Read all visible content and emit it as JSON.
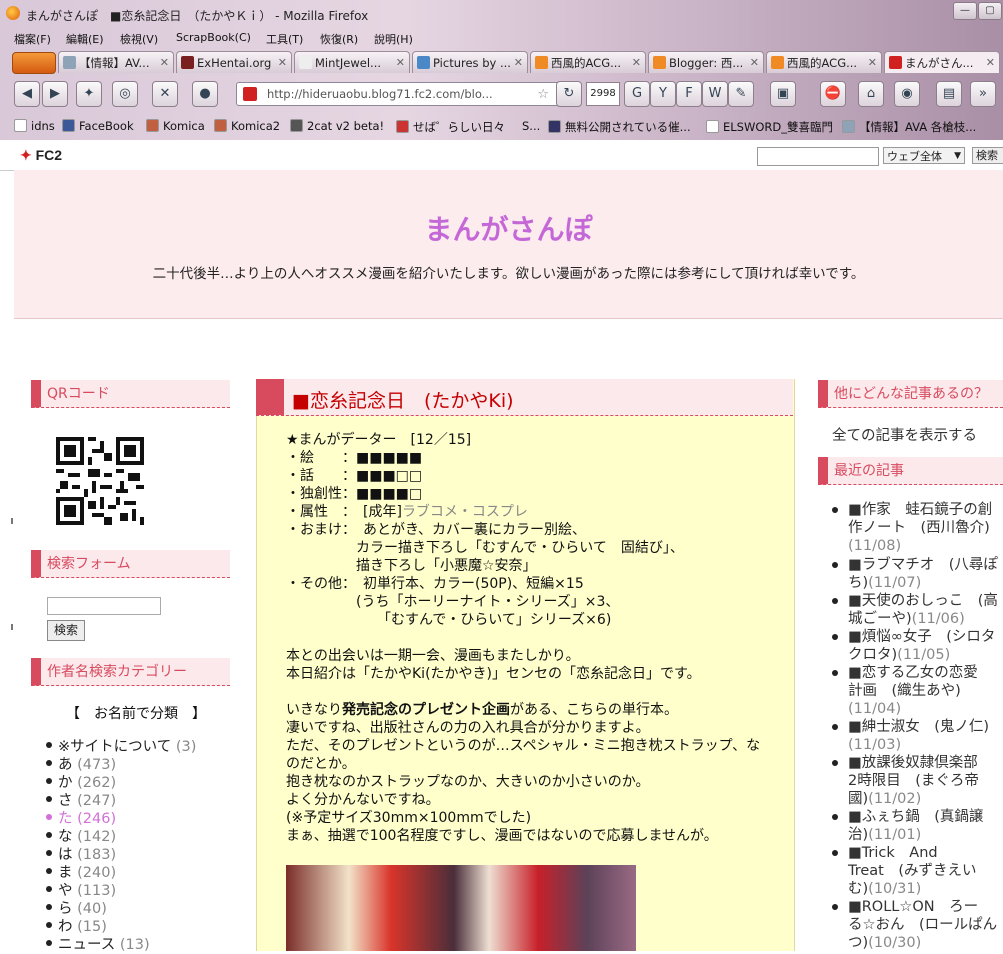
{
  "window": {
    "title": "まんがさんぽ　■恋糸記念日　（たかやＫｉ） - Mozilla Firefox",
    "buttons": [
      "—",
      "▢",
      "✕"
    ]
  },
  "menubar": [
    "檔案(F)",
    "編輯(E)",
    "檢視(V)",
    "ScrapBook(C)",
    "工具(T)",
    "恢復(R)",
    "說明(H)"
  ],
  "tabs": [
    {
      "label": "【情報】AV...",
      "icon_color": "#8fa3b8"
    },
    {
      "label": "ExHentai.org",
      "icon_color": "#7a1f1f"
    },
    {
      "label": "MintJewel...",
      "icon_color": "#eeeeee"
    },
    {
      "label": "Pictures by ...",
      "icon_color": "#4a88c8"
    },
    {
      "label": "西風的ACG...",
      "icon_color": "#f08a24"
    },
    {
      "label": "Blogger: 西...",
      "icon_color": "#f08a24"
    },
    {
      "label": "西風的ACG...",
      "icon_color": "#f08a24"
    },
    {
      "label": "まんがさん...",
      "icon_color": "#d02020"
    }
  ],
  "urlbar": {
    "url": "http://hideruaobu.blog71.fc2.com/blo..."
  },
  "toolbar": {
    "counter": "2998"
  },
  "bookmarks": [
    {
      "label": "idns",
      "icon_color": "#ffffff"
    },
    {
      "label": "FaceBook",
      "icon_color": "#3b5998"
    },
    {
      "label": "Komica",
      "icon_color": "#c06040"
    },
    {
      "label": "Komica2",
      "icon_color": "#c06040"
    },
    {
      "label": "2cat v2 beta!",
      "icon_color": "#555555"
    },
    {
      "label": "せば゜らしい日々",
      "icon_color": "#cc3333"
    },
    {
      "label": "S...",
      "icon_color": "#ffffff"
    },
    {
      "label": "無料公開されている催...",
      "icon_color": "#333366"
    },
    {
      "label": "ELSWORD_雙喜臨門",
      "icon_color": "#ffffff"
    },
    {
      "label": "【情報】AVA 各槍枝...",
      "icon_color": "#8fa3b8"
    }
  ],
  "fc2": {
    "logo": "FC2",
    "scope": "ウェブ全体",
    "search_button": "検索"
  },
  "site": {
    "title": "まんがさんぽ",
    "description": "二十代後半…より上の人へオススメ漫画を紹介いたします。欲しい漫画があった際には参考にして頂ければ幸いです。"
  },
  "left_sidebar": {
    "qr_heading": "QRコード",
    "search_heading": "検索フォーム",
    "search_button": "検索",
    "category_heading": "作者名検索カテゴリー",
    "category_subheading": "【　お名前で分類　】",
    "categories": [
      {
        "name": "※サイトについて",
        "count": "(3)"
      },
      {
        "name": "あ",
        "count": "(473)"
      },
      {
        "name": "か",
        "count": "(262)"
      },
      {
        "name": "さ",
        "count": "(247)"
      },
      {
        "name": "た",
        "count": "(246)"
      },
      {
        "name": "な",
        "count": "(142)"
      },
      {
        "name": "は",
        "count": "(183)"
      },
      {
        "name": "ま",
        "count": "(240)"
      },
      {
        "name": "や",
        "count": "(113)"
      },
      {
        "name": "ら",
        "count": "(40)"
      },
      {
        "name": "わ",
        "count": "(15)"
      },
      {
        "name": "ニュース",
        "count": "(13)"
      }
    ]
  },
  "article": {
    "title": "■恋糸記念日　(たかやKi)",
    "lines": [
      {
        "text": "★まんがデーター　[12／15]"
      },
      {
        "text": "・絵　　：■■■■■"
      },
      {
        "text": "・話　　：■■■□□"
      },
      {
        "text": "・独創性：■■■■□"
      },
      {
        "text": "・属性　：　[成年]",
        "gray": "ラブコメ・コスプレ"
      },
      {
        "text": "・おまけ：　あとがき、カバー裏にカラー別絵、"
      },
      {
        "text": "　　　　　カラー描き下ろし「むすんで・ひらいて　固結び」、"
      },
      {
        "text": "　　　　　描き下ろし「小悪魔☆安奈」"
      },
      {
        "text": "・その他：　初単行本、カラー(50P)、短編×15"
      },
      {
        "text": "　　　　　(うち「ホーリーナイト・シリーズ」×3、"
      },
      {
        "text": "　　　　　　　「むすんで・ひらいて」シリーズ×6)"
      },
      {
        "text": ""
      },
      {
        "text": "本との出会いは一期一会、漫画もまたしかり。"
      },
      {
        "text": "本日紹介は「たかやKi(たかやき)」センセの「恋糸記念日」です。"
      },
      {
        "text": ""
      },
      {
        "text": "いきなり",
        "bold": "発売記念のプレゼント企画",
        "tail": "がある、こちらの単行本。"
      },
      {
        "text": "凄いですね、出版社さんの力の入れ具合が分かりますよ。"
      },
      {
        "text": "ただ、そのプレゼントというのが…スペシャル・ミニ抱き枕ストラップ、な"
      },
      {
        "text": "のだとか。"
      },
      {
        "text": "抱き枕なのかストラップなのか、大きいのか小さいのか。"
      },
      {
        "text": "よく分かんないですね。"
      },
      {
        "text": "(※予定サイズ30mm×100mmでした)"
      },
      {
        "text": "まぁ、抽選で100名程度ですし、漫画ではないので応募しませんが。"
      }
    ]
  },
  "right_sidebar": {
    "other_heading": "他にどんな記事あるの？",
    "show_all": "全ての記事を表示する",
    "recent_heading": "最近の記事",
    "recent": [
      {
        "lines": [
          "■作家　蛙石鏡子の創",
          "作ノート　(西川魯介)"
        ],
        "date": "(11/08)"
      },
      {
        "lines": [
          "■ラブマチオ　(八尋ぽ",
          "ち)"
        ],
        "date": "(11/07)"
      },
      {
        "lines": [
          "■天使のおしっこ　(高",
          "城ごーや)"
        ],
        "date": "(11/06)"
      },
      {
        "lines": [
          "■煩悩∞女子　(シロタ",
          "クロタ)"
        ],
        "date": "(11/05)"
      },
      {
        "lines": [
          "■恋する乙女の恋愛",
          "計画　(織生あや)"
        ],
        "date": "(11/04)"
      },
      {
        "lines": [
          "■紳士淑女　(鬼ノ仁)"
        ],
        "date": "(11/03)"
      },
      {
        "lines": [
          "■放課後奴隷倶楽部",
          "2時限目　(まぐろ帝",
          "國)"
        ],
        "date": "(11/02)"
      },
      {
        "lines": [
          "■ふぇち鍋　(真鍋譲",
          "治)"
        ],
        "date": "(11/01)"
      },
      {
        "lines": [
          "■Trick　And",
          "Treat　(みずきえい",
          "む)"
        ],
        "date": "(10/31)"
      },
      {
        "lines": [
          "■ROLL☆ON　ろー",
          "る☆おん　(ロールぱん",
          "つ)"
        ],
        "date": "(10/30)"
      }
    ]
  }
}
